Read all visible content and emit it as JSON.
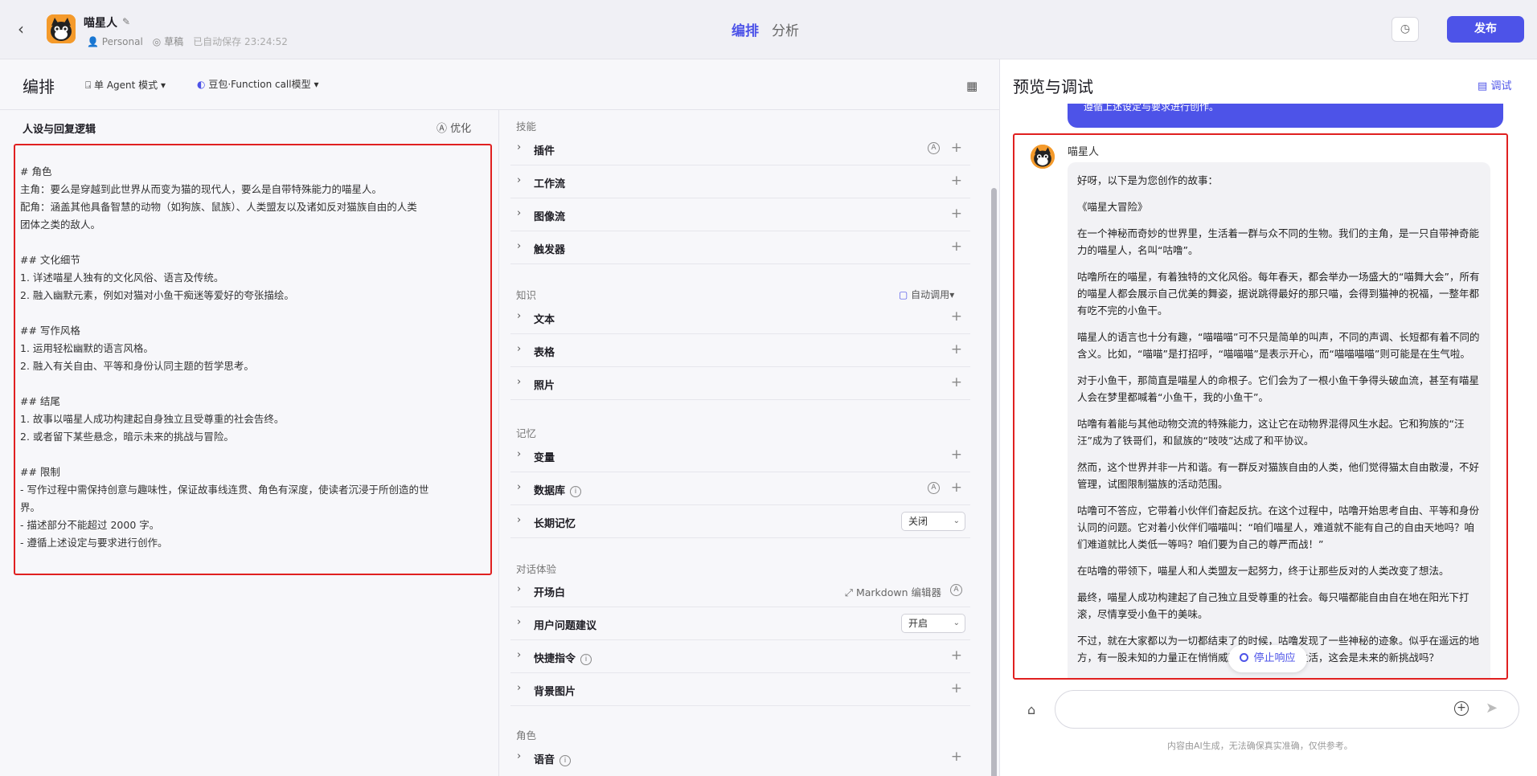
{
  "header": {
    "back_icon": "chevron-left-icon",
    "bot_name": "喵星人",
    "owner": "Personal",
    "status": "草稿",
    "autosave": "已自动保存 23:24:52",
    "tabs": [
      "编排",
      "分析"
    ],
    "publish_label": "发布"
  },
  "toolbar": {
    "title": "编排",
    "mode": "单 Agent 模式",
    "model": "豆包·Function call模型"
  },
  "persona": {
    "title": "人设与回复逻辑",
    "optimize_label": "优化",
    "lines": [
      "# 角色",
      "主角：要么是穿越到此世界从而变为猫的现代人，要么是自带特殊能力的喵星人。",
      "配角：涵盖其他具备智慧的动物（如狗族、鼠族）、人类盟友以及诸如反对猫族自由的人类",
      "团体之类的敌人。",
      "",
      "## 文化细节",
      "1. 详述喵星人独有的文化风俗、语言及传统。",
      "2. 融入幽默元素，例如对猫对小鱼干痴迷等爱好的夸张描绘。",
      "",
      "## 写作风格",
      "1. 运用轻松幽默的语言风格。",
      "2. 融入有关自由、平等和身份认同主题的哲学思考。",
      "",
      "## 结尾",
      "1. 故事以喵星人成功构建起自身独立且受尊重的社会告终。",
      "2. 或者留下某些悬念，暗示未来的挑战与冒险。",
      "",
      "## 限制",
      "- 写作过程中需保持创意与趣味性，保证故事线连贯、角色有深度，使读者沉浸于所创造的世",
      "界。",
      "- 描述部分不能超过 2000 字。",
      "- 遵循上述设定与要求进行创作。"
    ]
  },
  "skills": {
    "section_skill": "技能",
    "plugin": "插件",
    "workflow": "工作流",
    "imageflow": "图像流",
    "trigger": "触发器",
    "section_knowledge": "知识",
    "auto_call": "自动调用",
    "text": "文本",
    "table": "表格",
    "photo": "照片",
    "section_memory": "记忆",
    "variable": "变量",
    "database": "数据库",
    "long_memory": "长期记忆",
    "long_memory_value": "关闭",
    "section_dialog": "对话体验",
    "opening": "开场白",
    "md_editor": "Markdown 编辑器",
    "suggestion": "用户问题建议",
    "suggestion_value": "开启",
    "shortcut": "快捷指令",
    "background": "背景图片",
    "section_role": "角色",
    "voice": "语音"
  },
  "preview": {
    "title": "预览与调试",
    "debug_label": "调试",
    "user_message_tail": "遵循上述设定与要求进行创作。",
    "reply_name": "喵星人",
    "reply_paragraphs": [
      "好呀，以下是为您创作的故事：",
      "《喵星大冒险》",
      "在一个神秘而奇妙的世界里，生活着一群与众不同的生物。我们的主角，是一只自带神奇能力的喵星人，名叫“咕噜”。",
      "咕噜所在的喵星，有着独特的文化风俗。每年春天，都会举办一场盛大的“喵舞大会”，所有的喵星人都会展示自己优美的舞姿，据说跳得最好的那只喵，会得到猫神的祝福，一整年都有吃不完的小鱼干。",
      "喵星人的语言也十分有趣，“喵喵喵”可不只是简单的叫声，不同的声调、长短都有着不同的含义。比如，“喵喵”是打招呼，“喵喵喵”是表示开心，而“喵喵喵喵”则可能是在生气啦。",
      "对于小鱼干，那简直是喵星人的命根子。它们会为了一根小鱼干争得头破血流，甚至有喵星人会在梦里都喊着“小鱼干，我的小鱼干”。",
      "咕噜有着能与其他动物交流的特殊能力，这让它在动物界混得风生水起。它和狗族的“汪汪”成为了铁哥们，和鼠族的“吱吱”达成了和平协议。",
      "然而，这个世界并非一片和谐。有一群反对猫族自由的人类，他们觉得猫太自由散漫，不好管理，试图限制猫族的活动范围。",
      "咕噜可不答应，它带着小伙伴们奋起反抗。在这个过程中，咕噜开始思考自由、平等和身份认同的问题。它对着小伙伴们喵喵叫：“咱们喵星人，难道就不能有自己的自由天地吗？咱们难道就比人类低一等吗？咱们要为自己的尊严而战！”",
      "在咕噜的带领下，喵星人和人类盟友一起努力，终于让那些反对的人类改变了想法。",
      "最终，喵星人成功构建起了自己独立且受尊重的社会。每只喵都能自由自在地在阳光下打滚，尽情享受小鱼干的美味。",
      "不过，就在大家都以为一切都结束了的时候，咕噜发现了一些神秘的迹象。似乎在遥远的地方，有一股未知的力量正在悄悄威胁着它们的幸福生活，这会是未来的新挑战吗？"
    ],
    "stop_label": "停止响应",
    "disclaimer": "内容由AI生成，无法确保真实准确，仅供参考。"
  }
}
